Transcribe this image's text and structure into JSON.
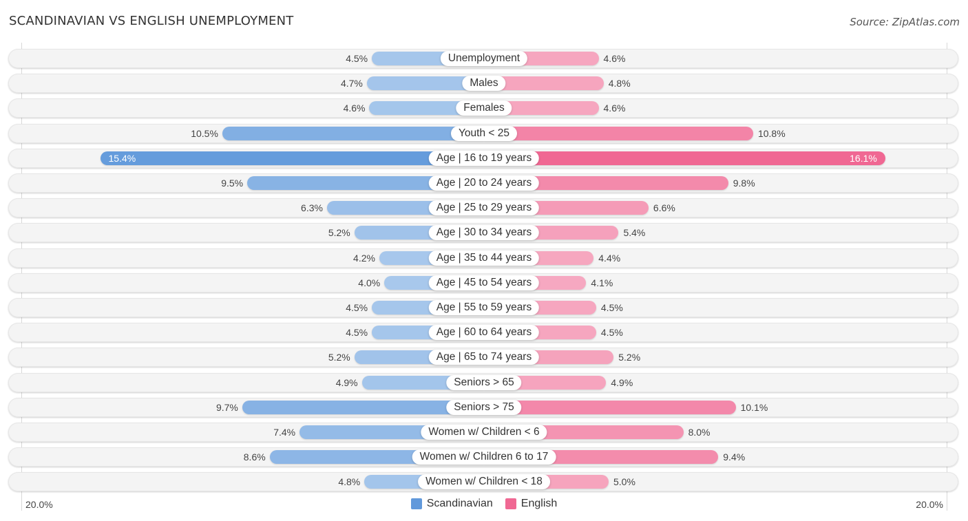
{
  "header": {
    "title": "SCANDINAVIAN VS ENGLISH UNEMPLOYMENT",
    "source": "Source: ZipAtlas.com"
  },
  "colors": {
    "scandinavian_strong": "#6199db",
    "scandinavian_light": "#a8c8ec",
    "english_strong": "#f06893",
    "english_light": "#f6a9c1",
    "track": "#f4f4f4"
  },
  "chart_data": {
    "type": "bar",
    "orientation": "horizontal-diverging",
    "title": "SCANDINAVIAN VS ENGLISH UNEMPLOYMENT",
    "xlabel": "",
    "ylabel": "",
    "xlim": [
      0,
      20.0
    ],
    "axis_labels": {
      "left": "20.0%",
      "right": "20.0%"
    },
    "legend": {
      "position": "bottom-center",
      "entries": [
        "Scandinavian",
        "English"
      ]
    },
    "categories": [
      "Unemployment",
      "Males",
      "Females",
      "Youth < 25",
      "Age | 16 to 19 years",
      "Age | 20 to 24 years",
      "Age | 25 to 29 years",
      "Age | 30 to 34 years",
      "Age | 35 to 44 years",
      "Age | 45 to 54 years",
      "Age | 55 to 59 years",
      "Age | 60 to 64 years",
      "Age | 65 to 74 years",
      "Seniors > 65",
      "Seniors > 75",
      "Women w/ Children < 6",
      "Women w/ Children 6 to 17",
      "Women w/ Children < 18"
    ],
    "series": [
      {
        "name": "Scandinavian",
        "side": "left",
        "values": [
          4.5,
          4.7,
          4.6,
          10.5,
          15.4,
          9.5,
          6.3,
          5.2,
          4.2,
          4.0,
          4.5,
          4.5,
          5.2,
          4.9,
          9.7,
          7.4,
          8.6,
          4.8
        ],
        "labels": [
          "4.5%",
          "4.7%",
          "4.6%",
          "10.5%",
          "15.4%",
          "9.5%",
          "6.3%",
          "5.2%",
          "4.2%",
          "4.0%",
          "4.5%",
          "4.5%",
          "5.2%",
          "4.9%",
          "9.7%",
          "7.4%",
          "8.6%",
          "4.8%"
        ]
      },
      {
        "name": "English",
        "side": "right",
        "values": [
          4.6,
          4.8,
          4.6,
          10.8,
          16.1,
          9.8,
          6.6,
          5.4,
          4.4,
          4.1,
          4.5,
          4.5,
          5.2,
          4.9,
          10.1,
          8.0,
          9.4,
          5.0
        ],
        "labels": [
          "4.6%",
          "4.8%",
          "4.6%",
          "10.8%",
          "16.1%",
          "9.8%",
          "6.6%",
          "5.4%",
          "4.4%",
          "4.1%",
          "4.5%",
          "4.5%",
          "5.2%",
          "4.9%",
          "10.1%",
          "8.0%",
          "9.4%",
          "5.0%"
        ]
      }
    ]
  }
}
